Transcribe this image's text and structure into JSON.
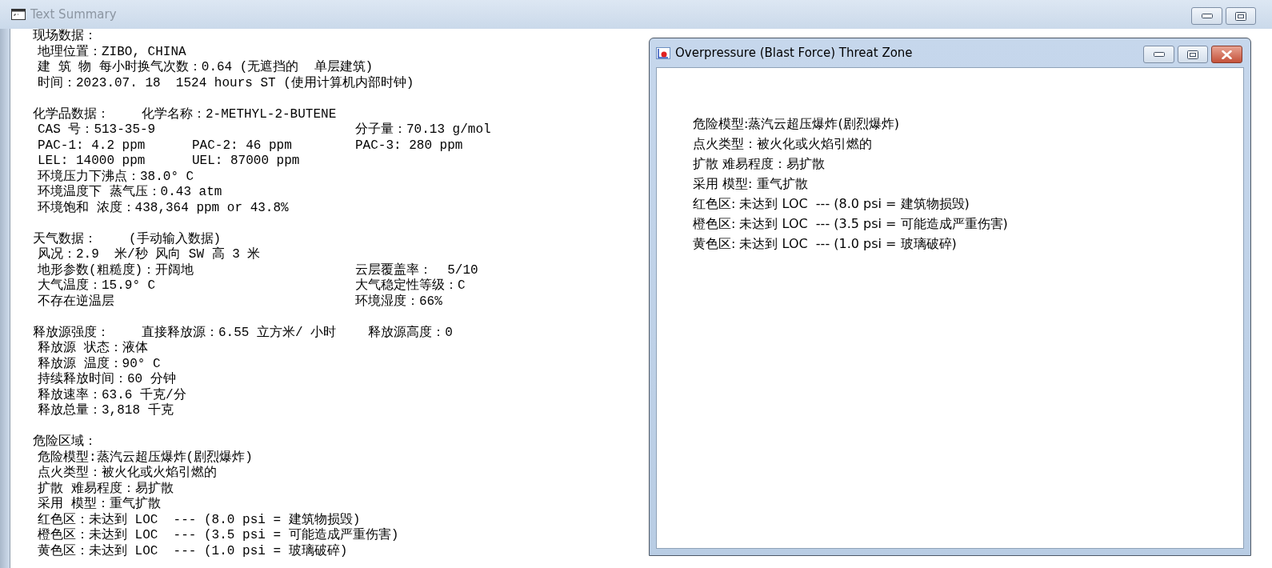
{
  "background_window": {
    "title": "Text Summary",
    "sections": [
      {
        "heading": [
          "现场数据："
        ],
        "rows": [
          {
            "left": "地理位置：ZIBO, CHINA"
          },
          {
            "left": "建 筑 物 每小时换气次数：0.64 (无遮挡的  单层建筑)"
          },
          {
            "left": "时间：2023.07. 18  1524 hours ST (使用计算机内部时钟)"
          }
        ]
      },
      {
        "heading": [
          "化学品数据：",
          "化学名称：2-METHYL-2-BUTENE"
        ],
        "rows": [
          {
            "left": "CAS 号：513-35-9",
            "right": "分子量：70.13 g/mol"
          },
          {
            "left": "PAC-1: 4.2 ppm",
            "middle": "PAC-2: 46 ppm",
            "right": "PAC-3: 280 ppm"
          },
          {
            "left": "LEL: 14000 ppm",
            "middle": "UEL: 87000 ppm"
          },
          {
            "left": "环境压力下沸点：38.0° C"
          },
          {
            "left": "环境温度下 蒸气压：0.43 atm"
          },
          {
            "left": "环境饱和 浓度：438,364 ppm or 43.8%"
          }
        ]
      },
      {
        "heading": [
          "天气数据：",
          "(手动输入数据)"
        ],
        "rows": [
          {
            "left": "风况：2.9  米/秒 风向 SW 高 3 米"
          },
          {
            "left": "地形参数(粗糙度)：开阔地",
            "right": "云层覆盖率：  5/10"
          },
          {
            "left": "大气温度：15.9° C",
            "right": "大气稳定性等级：C"
          },
          {
            "left": "不存在逆温层",
            "right": "环境湿度：66%"
          }
        ]
      },
      {
        "heading": [
          "释放源强度：",
          "直接释放源：6.55 立方米/ 小时",
          "释放源高度：0"
        ],
        "rows": [
          {
            "left": "释放源 状态：液体"
          },
          {
            "left": "释放源 温度：90° C"
          },
          {
            "left": "持续释放时间：60 分钟"
          },
          {
            "left": "释放速率：63.6 千克/分"
          },
          {
            "left": "释放总量：3,818 千克"
          }
        ]
      },
      {
        "heading": [
          "危险区域："
        ],
        "rows": [
          {
            "left": "危险模型:蒸汽云超压爆炸(剧烈爆炸)"
          },
          {
            "left": "点火类型：被火化或火焰引燃的"
          },
          {
            "left": "扩散 难易程度：易扩散"
          },
          {
            "left": "采用 模型：重气扩散"
          },
          {
            "left": "红色区：未达到 LOC  --- (8.0 psi = 建筑物损毁)"
          },
          {
            "left": "橙色区：未达到 LOC  --- (3.5 psi = 可能造成严重伤害)"
          },
          {
            "left": "黄色区：未达到 LOC  --- (1.0 psi = 玻璃破碎)"
          }
        ]
      }
    ]
  },
  "threat_window": {
    "title": "Overpressure (Blast Force) Threat Zone",
    "lines": [
      "危险模型:蒸汽云超压爆炸(剧烈爆炸)",
      "点火类型：被火化或火焰引燃的",
      "扩散 难易程度：易扩散",
      "采用 模型: 重气扩散",
      "红色区: 未达到 LOC  --- (8.0 psi = 建筑物损毁)",
      "橙色区: 未达到 LOC  --- (3.5 psi = 可能造成严重伤害)",
      "黄色区: 未达到 LOC  --- (1.0 psi = 玻璃破碎)"
    ]
  }
}
